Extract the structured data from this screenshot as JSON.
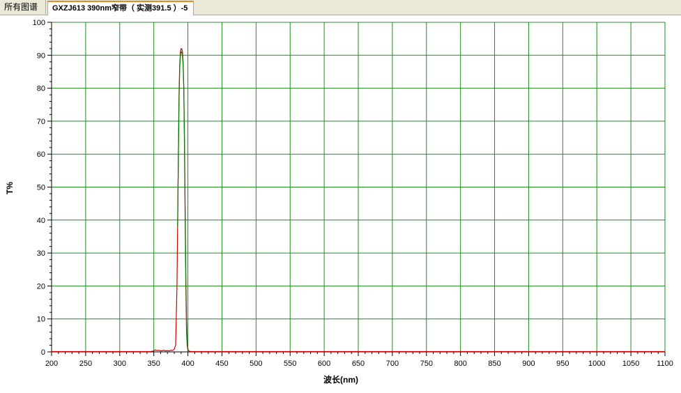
{
  "tabs": [
    {
      "label": "所有图谱",
      "active": false
    },
    {
      "label": "GXZJ613 390nm窄带（ 实测391.5 ）-5",
      "active": true
    }
  ],
  "colors": {
    "grid": "#1e8c1e",
    "curve_red": "#cc0000",
    "curve_green": "#008000",
    "axis": "#000000"
  },
  "chart_data": {
    "type": "line",
    "title": "",
    "xlabel": "波长(nm)",
    "ylabel": "T%",
    "xlim": [
      200,
      1100
    ],
    "ylim": [
      0,
      100
    ],
    "xticks": [
      200,
      250,
      300,
      350,
      400,
      450,
      500,
      550,
      600,
      650,
      700,
      750,
      800,
      850,
      900,
      950,
      1000,
      1050,
      1100
    ],
    "yticks": [
      0,
      10,
      20,
      30,
      40,
      50,
      60,
      70,
      80,
      90,
      100
    ],
    "grid": true,
    "series": [
      {
        "color": "#cc0000",
        "x": [
          200,
          345,
          350,
          352,
          355,
          358,
          360,
          363,
          365,
          367,
          370,
          373,
          375,
          377,
          380,
          382,
          384,
          385,
          386,
          387,
          388,
          389,
          390,
          391,
          392,
          393,
          394,
          395,
          396,
          397,
          398,
          399,
          400,
          402,
          405,
          450,
          500,
          600,
          700,
          800,
          900,
          1000,
          1100
        ],
        "y": [
          0.1,
          0.1,
          0.3,
          0.6,
          0.4,
          0.5,
          0.3,
          0.4,
          0.5,
          0.3,
          0.4,
          0.3,
          0.5,
          0.4,
          0.8,
          2,
          20,
          40,
          60,
          78,
          87,
          91,
          92,
          92,
          91,
          88,
          80,
          62,
          40,
          20,
          6,
          2,
          0.5,
          0.2,
          0.1,
          0.1,
          0.1,
          0.1,
          0.1,
          0.1,
          0.1,
          0.1,
          0.1
        ]
      },
      {
        "color": "#008000",
        "x": [
          385,
          386,
          387,
          388,
          389,
          390,
          391,
          392,
          393,
          394,
          395,
          396,
          397,
          398,
          399,
          400,
          401
        ],
        "y": [
          38,
          58,
          76,
          86,
          90,
          91,
          91,
          90,
          87,
          80,
          64,
          44,
          24,
          10,
          3,
          1,
          0.3
        ]
      }
    ]
  }
}
